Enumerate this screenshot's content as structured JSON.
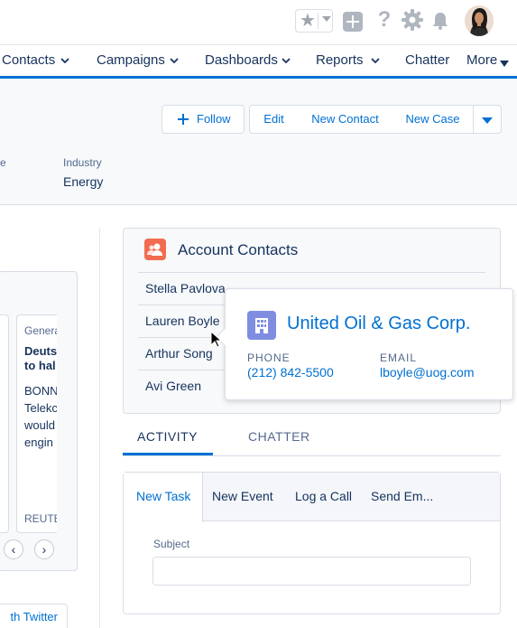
{
  "header": {
    "favorites_icon": "star-icon",
    "actions": [
      "plus-icon",
      "help-icon",
      "gear-icon",
      "bell-icon"
    ],
    "help_glyph": "?"
  },
  "nav": {
    "items": [
      {
        "label": "Contacts",
        "has_menu": true
      },
      {
        "label": "Campaigns",
        "has_menu": true
      },
      {
        "label": "Dashboards",
        "has_menu": true
      },
      {
        "label": "Reports",
        "has_menu": true
      },
      {
        "label": "Chatter",
        "has_menu": false
      },
      {
        "label": "More",
        "has_menu": true
      }
    ],
    "accent_color": "#0070d2"
  },
  "record_actions": {
    "follow": "Follow",
    "edit": "Edit",
    "new_contact": "New Contact",
    "new_case": "New Case"
  },
  "highlights": {
    "partial_label": "e",
    "industry_label": "Industry",
    "industry_value": "Energy"
  },
  "news": {
    "category": "Genera",
    "title": "Deuts to hal",
    "body_lines": [
      "BONN",
      "Telekc",
      "would",
      "engin"
    ],
    "source": "REUTE",
    "prev_glyph": "‹",
    "next_glyph": "›",
    "twitter_button": "th Twitter"
  },
  "contacts_card": {
    "title": "Account Contacts",
    "contacts": [
      "Stella Pavlova",
      "Lauren Boyle",
      "Arthur Song",
      "Avi Green"
    ]
  },
  "popover": {
    "account_name": "United Oil & Gas Corp.",
    "phone_label": "PHONE",
    "phone_value": "(212) 842-5500",
    "email_label": "EMAIL",
    "email_value": "lboyle@uog.com"
  },
  "tabs": {
    "activity": "ACTIVITY",
    "chatter": "CHATTER"
  },
  "composer": {
    "tabs": [
      "New Task",
      "New Event",
      "Log a Call",
      "Send Em..."
    ],
    "subject_label": "Subject",
    "subject_value": ""
  }
}
